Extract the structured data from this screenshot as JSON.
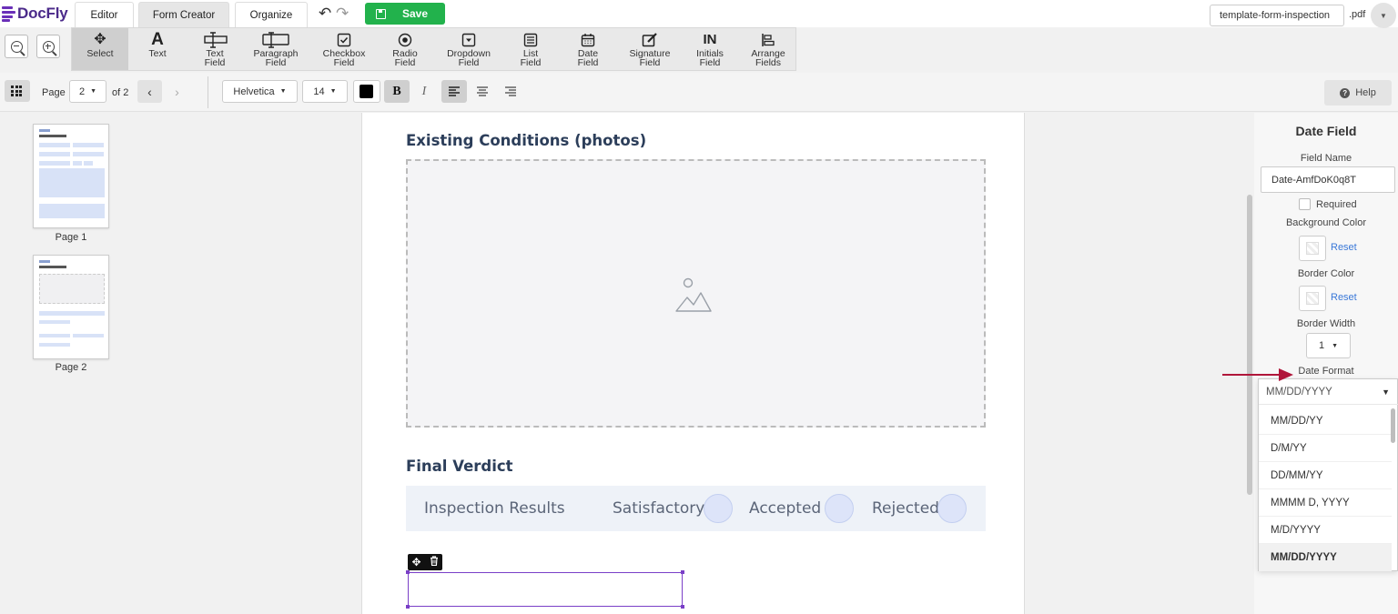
{
  "app": {
    "name": "DocFly"
  },
  "mode_tabs": [
    {
      "label": "Editor"
    },
    {
      "label": "Form Creator"
    },
    {
      "label": "Organize"
    }
  ],
  "save_label": "Save",
  "file": {
    "name": "template-form-inspection",
    "ext": ".pdf"
  },
  "tools": [
    {
      "label": "Select",
      "icon": "move-icon"
    },
    {
      "label": "Text",
      "icon": "text-icon"
    },
    {
      "label": "Text\nField",
      "icon": "text-field-icon"
    },
    {
      "label": "Paragraph\nField",
      "icon": "paragraph-field-icon"
    },
    {
      "label": "Checkbox\nField",
      "icon": "checkbox-icon"
    },
    {
      "label": "Radio\nField",
      "icon": "radio-icon"
    },
    {
      "label": "Dropdown\nField",
      "icon": "dropdown-icon"
    },
    {
      "label": "List\nField",
      "icon": "list-icon"
    },
    {
      "label": "Date\nField",
      "icon": "calendar-icon"
    },
    {
      "label": "Signature\nField",
      "icon": "signature-icon"
    },
    {
      "label": "Initials\nField",
      "icon": "initials-icon"
    },
    {
      "label": "Arrange\nFields",
      "icon": "arrange-icon"
    }
  ],
  "format": {
    "page_label": "Page",
    "page_value": "2",
    "page_of": "of 2",
    "font": "Helvetica",
    "size": "14",
    "text_color": "#000000",
    "bold": "B",
    "italic": "I",
    "help_label": "Help"
  },
  "thumbnails": [
    {
      "label": "Page 1"
    },
    {
      "label": "Page 2"
    }
  ],
  "page": {
    "existing_conditions": "Existing Conditions (photos)",
    "final_verdict": "Final Verdict",
    "inspection_results": "Inspection Results",
    "options": [
      "Satisfactory",
      "Accepted",
      "Rejected"
    ]
  },
  "panel": {
    "title": "Date Field",
    "field_name_label": "Field Name",
    "field_name_value": "Date-AmfDoK0q8T",
    "required_label": "Required",
    "bg_color_label": "Background Color",
    "border_color_label": "Border Color",
    "reset_label": "Reset",
    "border_width_label": "Border Width",
    "border_width_value": "1",
    "date_format_label": "Date Format",
    "date_format_value": "MM/DD/YYYY",
    "date_format_options": [
      "MM/DD/YY",
      "D/M/YY",
      "DD/MM/YY",
      "MMMM D, YYYY",
      "M/D/YYYY",
      "MM/DD/YYYY"
    ]
  },
  "colors": {
    "accent": "#6a2fb8",
    "save": "#22b24c",
    "arrow": "#b0163a"
  }
}
